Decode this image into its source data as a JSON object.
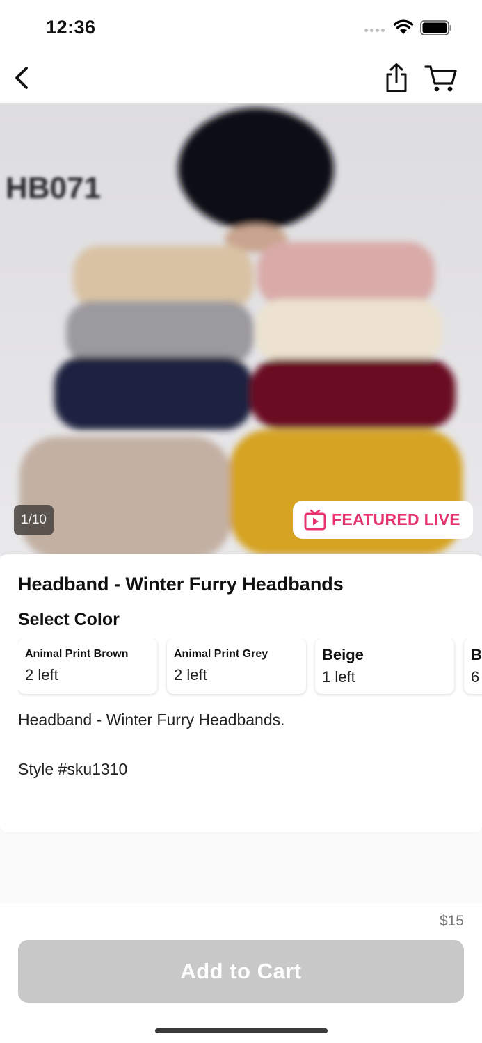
{
  "status_bar": {
    "time": "12:36"
  },
  "gallery": {
    "image_label": "HB071",
    "counter": "1/10",
    "featured_badge": "FEATURED LIVE"
  },
  "product": {
    "title": "Headband - Winter Furry Headbands",
    "select_color_label": "Select Color",
    "colors": [
      {
        "name": "Animal Print Brown",
        "stock": "2 left"
      },
      {
        "name": "Animal Print Grey",
        "stock": "2 left"
      },
      {
        "name": "Beige",
        "stock": "1 left"
      },
      {
        "name": "B",
        "stock": "6"
      }
    ],
    "description": "Headband - Winter Furry Headbands.",
    "style": "Style #sku1310"
  },
  "footer": {
    "price": "$15",
    "add_to_cart_label": "Add to Cart"
  },
  "colors": {
    "accent": "#e7336f",
    "disabled_button": "#c8c8c8"
  }
}
